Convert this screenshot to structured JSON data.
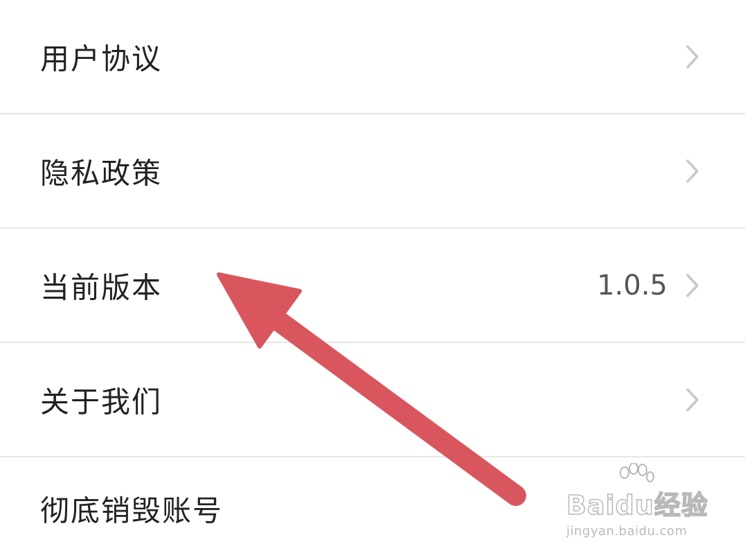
{
  "settings_list": {
    "items": [
      {
        "label": "用户协议",
        "value": "",
        "chevron": "chevron-right-icon"
      },
      {
        "label": "隐私政策",
        "value": "",
        "chevron": "chevron-right-icon"
      },
      {
        "label": "当前版本",
        "value": "1.0.5",
        "chevron": "chevron-right-icon"
      },
      {
        "label": "关于我们",
        "value": "",
        "chevron": "chevron-right-icon"
      },
      {
        "label": "彻底销毁账号",
        "value": "",
        "chevron": ""
      }
    ]
  },
  "annotation": {
    "icon": "pointer-arrow-icon",
    "color": "#d9565e"
  },
  "watermark": {
    "logo_text": "Baidu经验",
    "url": "jingyan.baidu.com"
  },
  "colors": {
    "background": "#ffffff",
    "divider": "#e6e6e6",
    "label_text": "#222222",
    "value_text": "#555555",
    "chevron": "#c8c8c8"
  }
}
